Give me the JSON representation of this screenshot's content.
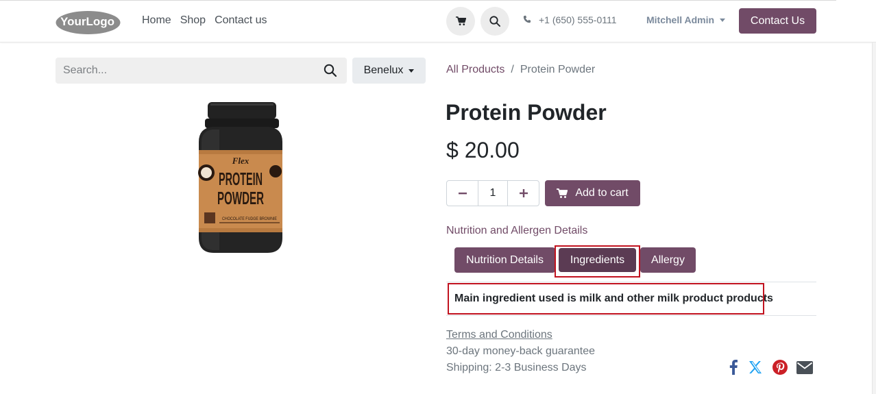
{
  "header": {
    "logo_text": "YourLogo",
    "nav": [
      {
        "label": "Home"
      },
      {
        "label": "Shop"
      },
      {
        "label": "Contact us"
      }
    ],
    "cart_icon": "cart-icon",
    "search_icon": "search-icon",
    "phone": "+1 (650) 555-0111",
    "user_name": "Mitchell Admin",
    "contact_button": "Contact Us"
  },
  "search": {
    "placeholder": "Search...",
    "region_label": "Benelux"
  },
  "breadcrumb": {
    "parent": "All Products",
    "separator": "/",
    "current": "Protein Powder"
  },
  "product": {
    "title": "Protein Powder",
    "price": "$ 20.00",
    "quantity": "1",
    "add_to_cart": "Add to cart",
    "image_text": {
      "brand": "Flex",
      "line1": "PROTEIN",
      "line2": "POWDER",
      "flavor": "CHOCOLATE FUDGE BROWNIE"
    }
  },
  "details": {
    "section_title": "Nutrition and Allergen Details",
    "tabs": [
      {
        "label": "Nutrition Details"
      },
      {
        "label": "Ingredients"
      },
      {
        "label": "Allergy"
      }
    ],
    "active_tab": "Ingredients",
    "content": "Main ingredient used is milk and other milk product products"
  },
  "footer_info": {
    "terms": "Terms and Conditions",
    "guarantee": "30-day money-back guarantee",
    "shipping": "Shipping: 2-3 Business Days"
  },
  "social": [
    {
      "icon": "facebook-icon",
      "color": "#3b5998"
    },
    {
      "icon": "x-twitter-icon",
      "color": "#1da1f2"
    },
    {
      "icon": "pinterest-icon",
      "color": "#cb2027"
    },
    {
      "icon": "email-icon",
      "color": "#495057"
    }
  ],
  "colors": {
    "primary": "#714b67",
    "highlight": "#c1121f"
  }
}
